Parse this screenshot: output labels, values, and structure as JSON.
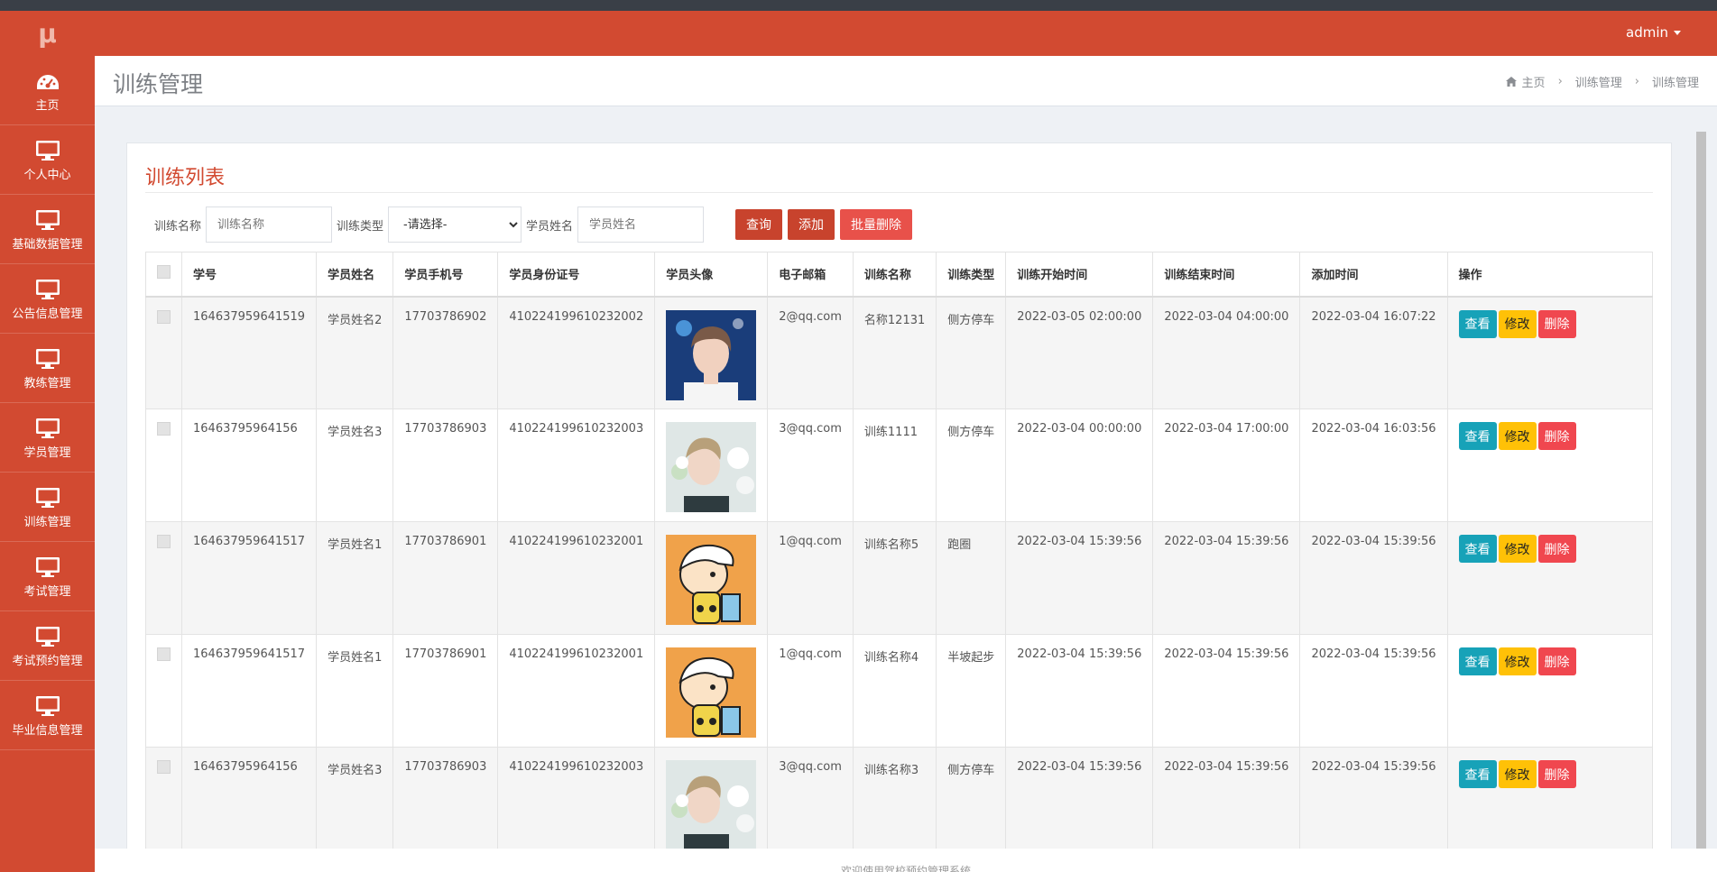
{
  "app": {
    "logo_text": "μ",
    "user_label": "admin"
  },
  "sidebar": {
    "items": [
      {
        "label": "主页",
        "icon": "dashboard-icon"
      },
      {
        "label": "个人中心",
        "icon": "monitor-icon"
      },
      {
        "label": "基础数据管理",
        "icon": "monitor-icon"
      },
      {
        "label": "公告信息管理",
        "icon": "monitor-icon"
      },
      {
        "label": "教练管理",
        "icon": "monitor-icon"
      },
      {
        "label": "学员管理",
        "icon": "monitor-icon"
      },
      {
        "label": "训练管理",
        "icon": "monitor-icon"
      },
      {
        "label": "考试管理",
        "icon": "monitor-icon"
      },
      {
        "label": "考试预约管理",
        "icon": "monitor-icon"
      },
      {
        "label": "毕业信息管理",
        "icon": "monitor-icon"
      }
    ]
  },
  "header": {
    "title": "训练管理",
    "breadcrumb": [
      "主页",
      "训练管理",
      "训练管理"
    ]
  },
  "panel": {
    "title": "训练列表"
  },
  "search": {
    "name_label": "训练名称",
    "name_placeholder": "训练名称",
    "type_label": "训练类型",
    "type_selected": "-请选择-",
    "student_label": "学员姓名",
    "student_placeholder": "学员姓名",
    "query_button": "查询",
    "add_button": "添加",
    "batch_delete_button": "批量删除"
  },
  "table": {
    "columns": [
      "学号",
      "学员姓名",
      "学员手机号",
      "学员身份证号",
      "学员头像",
      "电子邮箱",
      "训练名称",
      "训练类型",
      "训练开始时间",
      "训练结束时间",
      "添加时间",
      "操作"
    ],
    "op_labels": {
      "view": "查看",
      "edit": "修改",
      "delete": "删除"
    },
    "rows": [
      {
        "id": "164637959641519",
        "name": "学员姓名2",
        "phone": "17703786902",
        "idcard": "410224199610232002",
        "avatar": "photo-boy-blue",
        "email": "2@qq.com",
        "training": "名称12131",
        "type": "侧方停车",
        "start": "2022-03-05 02:00:00",
        "end": "2022-03-04 04:00:00",
        "added": "2022-03-04 16:07:22"
      },
      {
        "id": "16463795964156",
        "name": "学员姓名3",
        "phone": "17703786903",
        "idcard": "410224199610232003",
        "avatar": "photo-boy-flowers",
        "email": "3@qq.com",
        "training": "训练1111",
        "type": "侧方停车",
        "start": "2022-03-04 00:00:00",
        "end": "2022-03-04 17:00:00",
        "added": "2022-03-04 16:03:56"
      },
      {
        "id": "164637959641517",
        "name": "学员姓名1",
        "phone": "17703786901",
        "idcard": "410224199610232001",
        "avatar": "cartoon-kid",
        "email": "1@qq.com",
        "training": "训练名称5",
        "type": "跑圈",
        "start": "2022-03-04 15:39:56",
        "end": "2022-03-04 15:39:56",
        "added": "2022-03-04 15:39:56"
      },
      {
        "id": "164637959641517",
        "name": "学员姓名1",
        "phone": "17703786901",
        "idcard": "410224199610232001",
        "avatar": "cartoon-kid",
        "email": "1@qq.com",
        "training": "训练名称4",
        "type": "半坡起步",
        "start": "2022-03-04 15:39:56",
        "end": "2022-03-04 15:39:56",
        "added": "2022-03-04 15:39:56"
      },
      {
        "id": "16463795964156",
        "name": "学员姓名3",
        "phone": "17703786903",
        "idcard": "410224199610232003",
        "avatar": "photo-boy-flowers",
        "email": "3@qq.com",
        "training": "训练名称3",
        "type": "侧方停车",
        "start": "2022-03-04 15:39:56",
        "end": "2022-03-04 15:39:56",
        "added": "2022-03-04 15:39:56"
      }
    ]
  },
  "footer": {
    "text": "欢迎使用驾校预约管理系统"
  },
  "colors": {
    "brand": "#d24a31",
    "view_button": "#17a2b8",
    "edit_button": "#ffc107",
    "delete_button": "#f0474f"
  }
}
